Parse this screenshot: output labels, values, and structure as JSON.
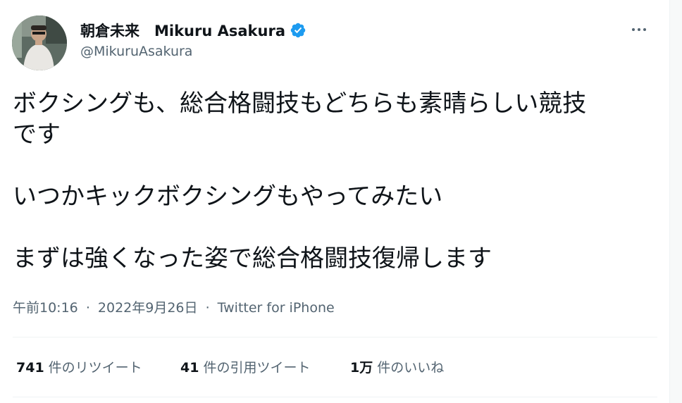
{
  "author": {
    "display_name": "朝倉未来　Mikuru Asakura",
    "handle": "@MikuruAsakura",
    "verified": true,
    "verified_color": "#1d9bf0"
  },
  "tweet": {
    "lines": [
      "ボクシングも、総合格闘技もどちらも素晴らしい競技",
      "です",
      "いつかキックボクシングもやってみたい",
      "まずは強くなった姿で総合格闘技復帰します"
    ]
  },
  "meta": {
    "time": "午前10:16",
    "separator": "·",
    "date": "2022年9月26日",
    "source": "Twitter for iPhone"
  },
  "stats": {
    "retweets": {
      "count": "741",
      "label": "件のリツイート"
    },
    "quotes": {
      "count": "41",
      "label": "件の引用ツイート"
    },
    "likes": {
      "count": "1万",
      "label": "件のいいね"
    }
  },
  "icons": {
    "more": "more-horizontal-icon",
    "verified": "verified-badge-icon"
  }
}
